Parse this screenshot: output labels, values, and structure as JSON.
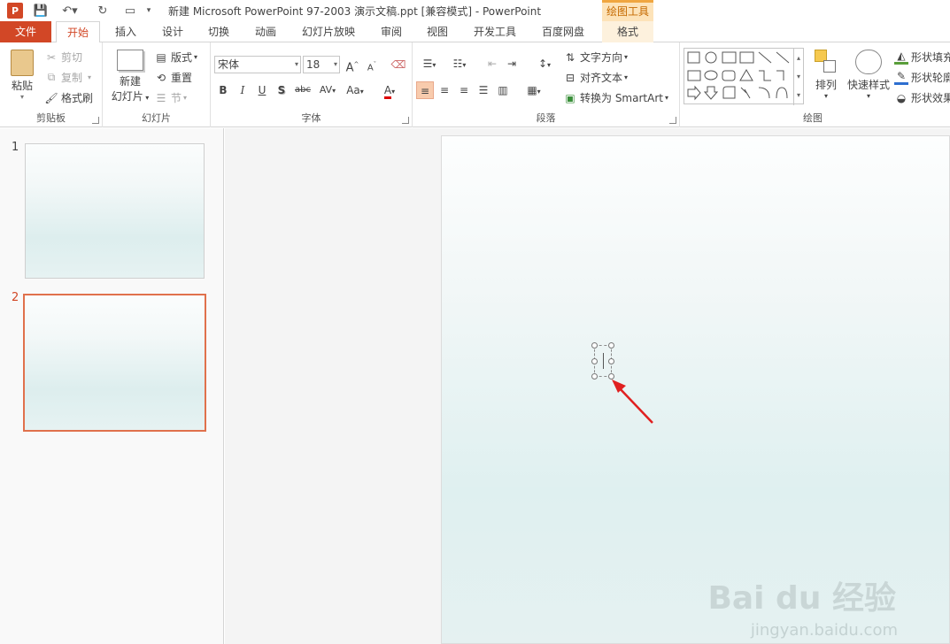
{
  "title_bar": {
    "app_logo": "P",
    "title": "新建 Microsoft PowerPoint 97-2003 演示文稿.ppt [兼容模式] - PowerPoint",
    "contextual_tab_group": "绘图工具"
  },
  "tabs": [
    {
      "label": "文件"
    },
    {
      "label": "开始"
    },
    {
      "label": "插入"
    },
    {
      "label": "设计"
    },
    {
      "label": "切换"
    },
    {
      "label": "动画"
    },
    {
      "label": "幻灯片放映"
    },
    {
      "label": "审阅"
    },
    {
      "label": "视图"
    },
    {
      "label": "开发工具"
    },
    {
      "label": "百度网盘"
    },
    {
      "label": "格式"
    }
  ],
  "active_tab": "开始",
  "ribbon": {
    "clipboard": {
      "label": "剪贴板",
      "paste": "粘贴",
      "cut": "剪切",
      "copy": "复制",
      "format_painter": "格式刷"
    },
    "slides": {
      "label": "幻灯片",
      "new_slide_1": "新建",
      "new_slide_2": "幻灯片",
      "layout": "版式",
      "reset": "重置",
      "section": "节"
    },
    "font": {
      "label": "字体",
      "font_name": "宋体",
      "font_size": "18",
      "grow": "A",
      "shrink": "A",
      "bold": "B",
      "italic": "I",
      "underline": "U",
      "shadow": "S",
      "strike": "abc",
      "spacing": "AV",
      "case": "Aa",
      "color": "A"
    },
    "paragraph": {
      "label": "段落",
      "text_direction": "文字方向",
      "align_text": "对齐文本",
      "convert_smartart": "转换为 SmartArt"
    },
    "drawing": {
      "label": "绘图",
      "arrange": "排列",
      "quick_styles": "快速样式",
      "shape_fill": "形状填充",
      "shape_outline": "形状轮廓",
      "shape_effects": "形状效果"
    }
  },
  "slides_panel": {
    "slides": [
      {
        "number": "1"
      },
      {
        "number": "2"
      }
    ],
    "selected": "2"
  },
  "watermark": {
    "brand": "Bai du 经验",
    "url": "jingyan.baidu.com"
  },
  "colors": {
    "accent": "#d24726",
    "contextual": "#f0a640",
    "slide_teal": "#dff0f0",
    "arrow": "#e02020"
  }
}
